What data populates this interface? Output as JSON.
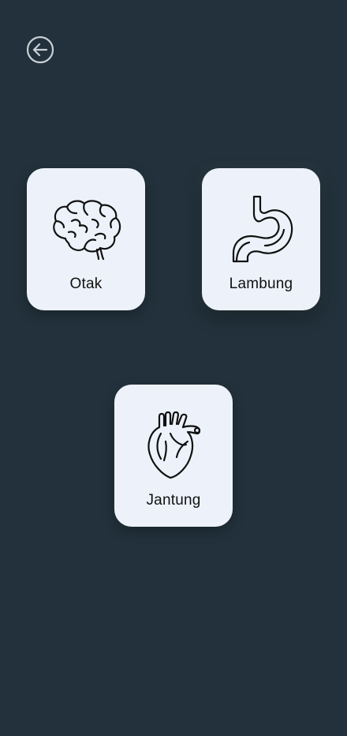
{
  "header": {
    "back_icon": "arrow-left-circle-icon"
  },
  "organs": [
    {
      "label": "Otak",
      "icon": "brain-icon"
    },
    {
      "label": "Lambung",
      "icon": "stomach-icon"
    },
    {
      "label": "Jantung",
      "icon": "heart-organ-icon"
    }
  ],
  "colors": {
    "background": "#22313b",
    "card": "#edf2fa",
    "text": "#111111",
    "back_icon": "#c9d0d6"
  }
}
